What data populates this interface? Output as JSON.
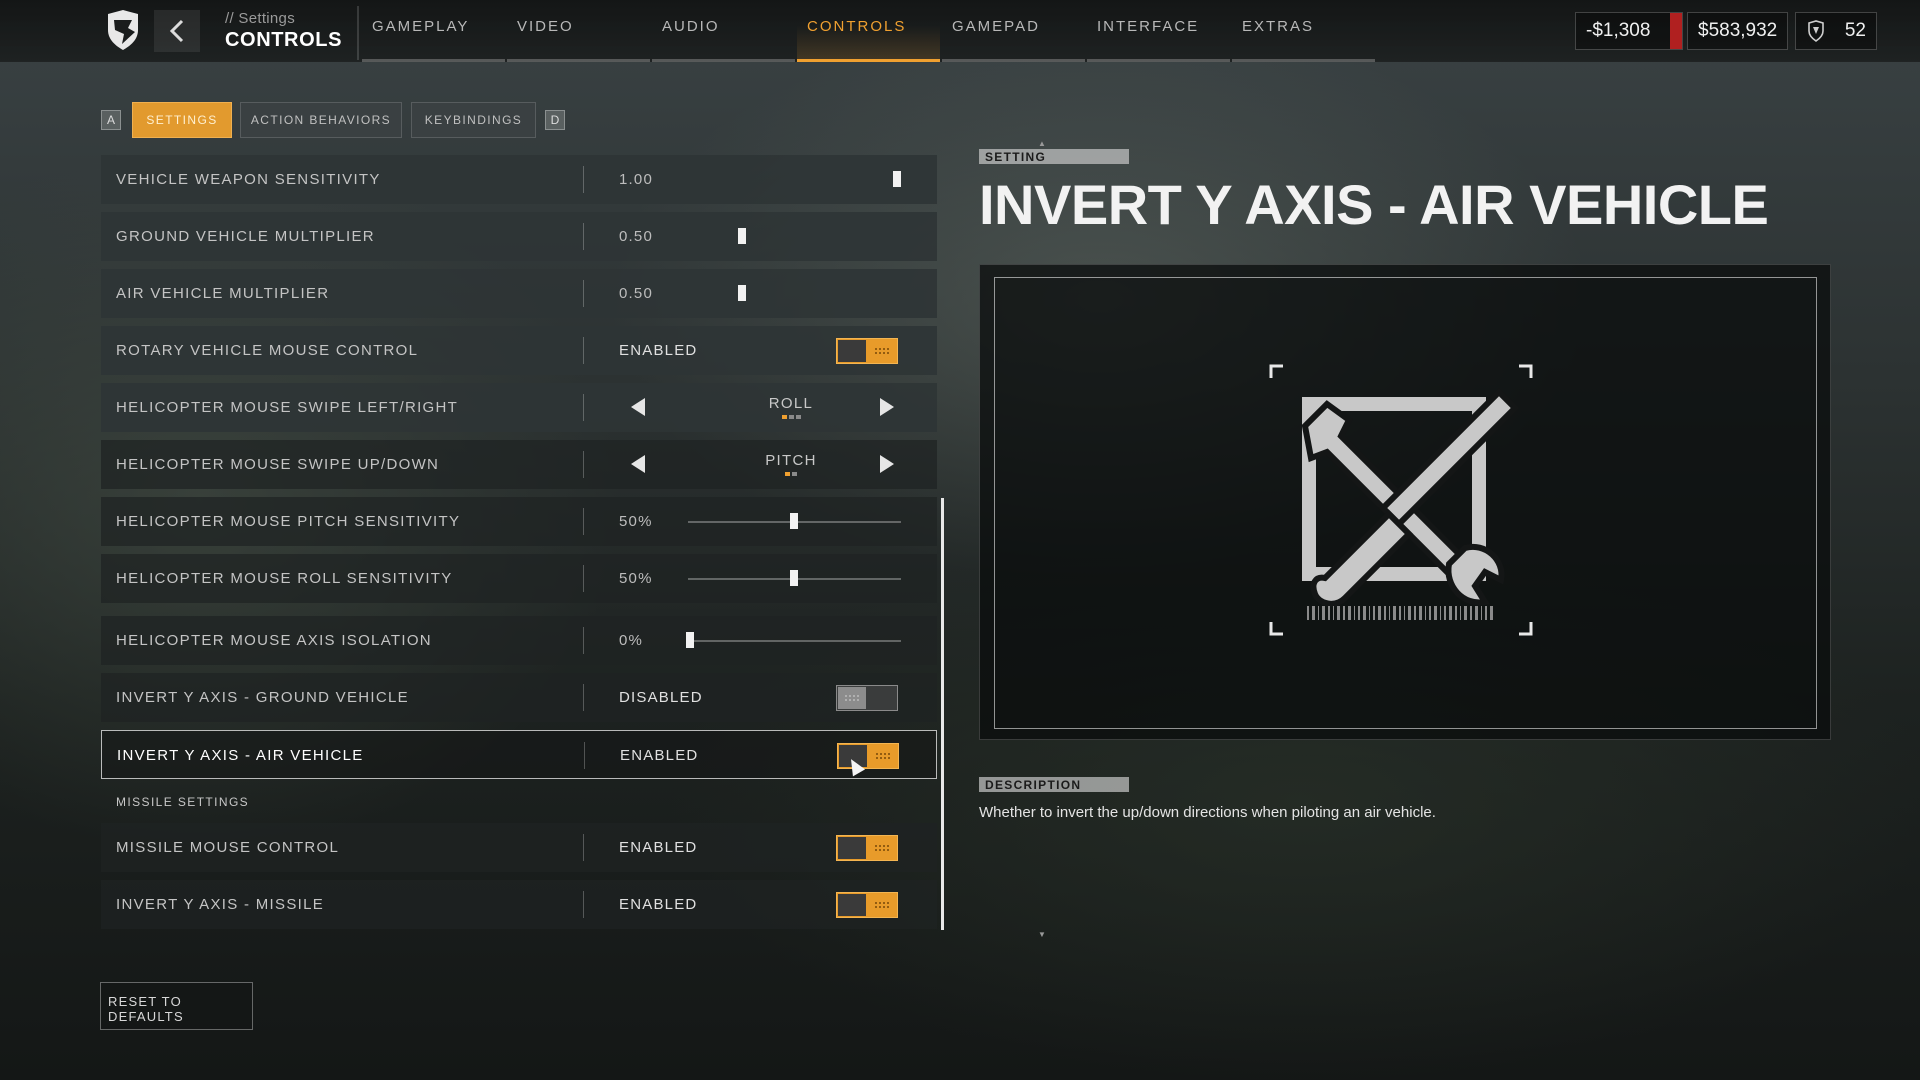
{
  "header": {
    "breadcrumb_sub": "// Settings",
    "breadcrumb_main": "CONTROLS",
    "tabs": [
      {
        "label": "GAMEPLAY",
        "active": false
      },
      {
        "label": "VIDEO",
        "active": false
      },
      {
        "label": "AUDIO",
        "active": false
      },
      {
        "label": "CONTROLS",
        "active": true
      },
      {
        "label": "GAMEPAD",
        "active": false
      },
      {
        "label": "INTERFACE",
        "active": false
      },
      {
        "label": "EXTRAS",
        "active": false
      }
    ],
    "wallet_negative": "-$1,308",
    "wallet_cash": "$583,932",
    "rank": "52"
  },
  "subtabs": {
    "key_left": "A",
    "key_right": "D",
    "items": [
      {
        "label": "SETTINGS",
        "active": true
      },
      {
        "label": "ACTION BEHAVIORS",
        "active": false
      },
      {
        "label": "KEYBINDINGS",
        "active": false
      }
    ]
  },
  "settings": {
    "rows": [
      {
        "label": "VEHICLE WEAPON SENSITIVITY",
        "value": "1.00",
        "control": "slider",
        "level": 1.0
      },
      {
        "label": "GROUND VEHICLE MULTIPLIER",
        "value": "0.50",
        "control": "slider",
        "level": 0.5
      },
      {
        "label": "AIR VEHICLE MULTIPLIER",
        "value": "0.50",
        "control": "slider",
        "level": 0.5
      },
      {
        "label": "ROTARY VEHICLE MOUSE CONTROL",
        "value": "ENABLED",
        "control": "toggle",
        "on": true
      },
      {
        "label": "HELICOPTER MOUSE SWIPE LEFT/RIGHT",
        "value": "ROLL",
        "control": "carousel"
      },
      {
        "label": "HELICOPTER MOUSE SWIPE UP/DOWN",
        "value": "PITCH",
        "control": "carousel"
      },
      {
        "label": "HELICOPTER MOUSE PITCH SENSITIVITY",
        "value": "50%",
        "control": "slider",
        "level": 0.5
      },
      {
        "label": "HELICOPTER MOUSE ROLL SENSITIVITY",
        "value": "50%",
        "control": "slider",
        "level": 0.5
      },
      {
        "label": "HELICOPTER MOUSE AXIS ISOLATION",
        "value": "0%",
        "control": "slider",
        "level": 0.0
      },
      {
        "label": "INVERT Y AXIS - GROUND VEHICLE",
        "value": "DISABLED",
        "control": "toggle",
        "on": false
      },
      {
        "label": "INVERT Y AXIS - AIR VEHICLE",
        "value": "ENABLED",
        "control": "toggle",
        "on": true,
        "selected": true
      },
      {
        "label": "MISSILE MOUSE CONTROL",
        "value": "ENABLED",
        "control": "toggle",
        "on": true
      },
      {
        "label": "INVERT Y AXIS - MISSILE",
        "value": "ENABLED",
        "control": "toggle",
        "on": true
      }
    ],
    "section_missile": "MISSILE SETTINGS",
    "reset_label": "RESET TO DEFAULTS"
  },
  "detail": {
    "setting_tag": "SETTING",
    "title": "INVERT Y AXIS - AIR VEHICLE",
    "description_tag": "DESCRIPTION",
    "description": "Whether to invert the up/down directions when piloting an air vehicle.",
    "preview_icon": "wrench-screwdriver-icon"
  },
  "colors": {
    "accent": "#f0a030",
    "toggle_on": "#e89b2a",
    "alert": "#b02020"
  }
}
